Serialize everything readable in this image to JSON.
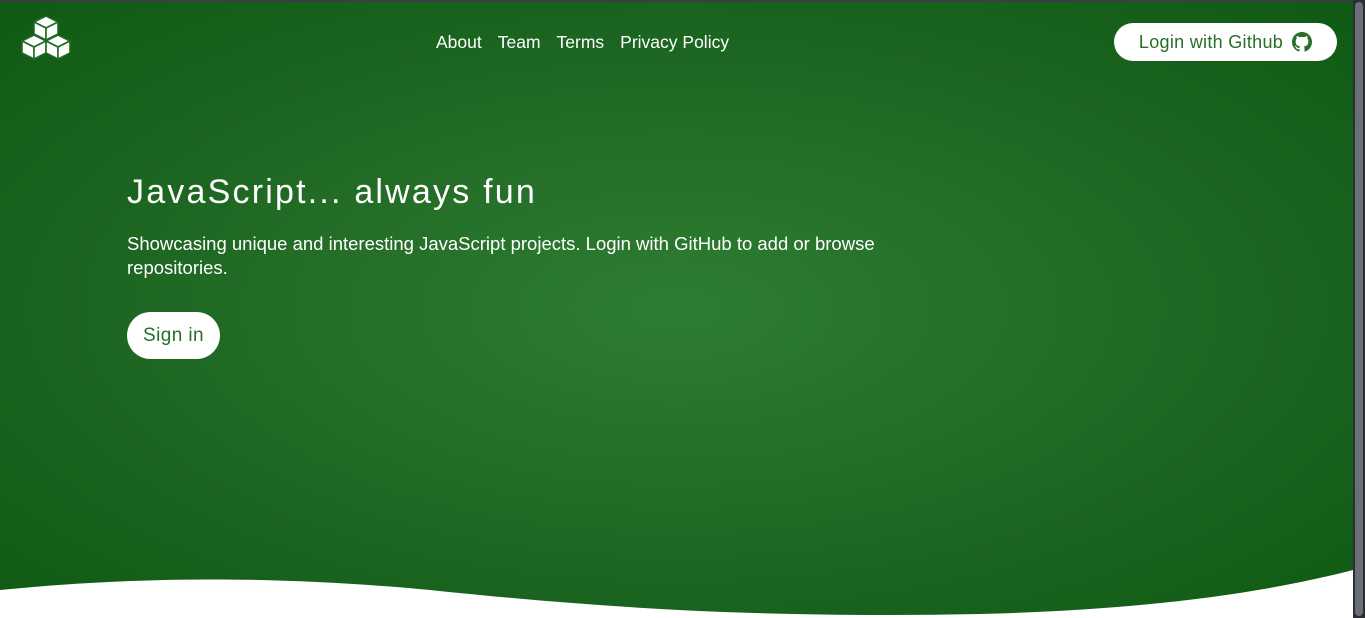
{
  "header": {
    "logo_icon": "cubes-icon",
    "nav": [
      {
        "label": "About"
      },
      {
        "label": "Team"
      },
      {
        "label": "Terms"
      },
      {
        "label": "Privacy Policy"
      }
    ],
    "login_button": {
      "label": "Login with Github",
      "icon": "github-icon"
    }
  },
  "hero": {
    "headline": "JavaScript... always fun",
    "lead": "Showcasing unique and interesting JavaScript projects. Login with GitHub to add or browse repositories.",
    "cta_label": "Sign in"
  },
  "colors": {
    "brand_green": "#256f28",
    "hero_gradient_center": "#2e7d32",
    "hero_gradient_edge": "#0f5a12",
    "text_on_brand": "#ffffff",
    "button_bg": "#ffffff"
  }
}
